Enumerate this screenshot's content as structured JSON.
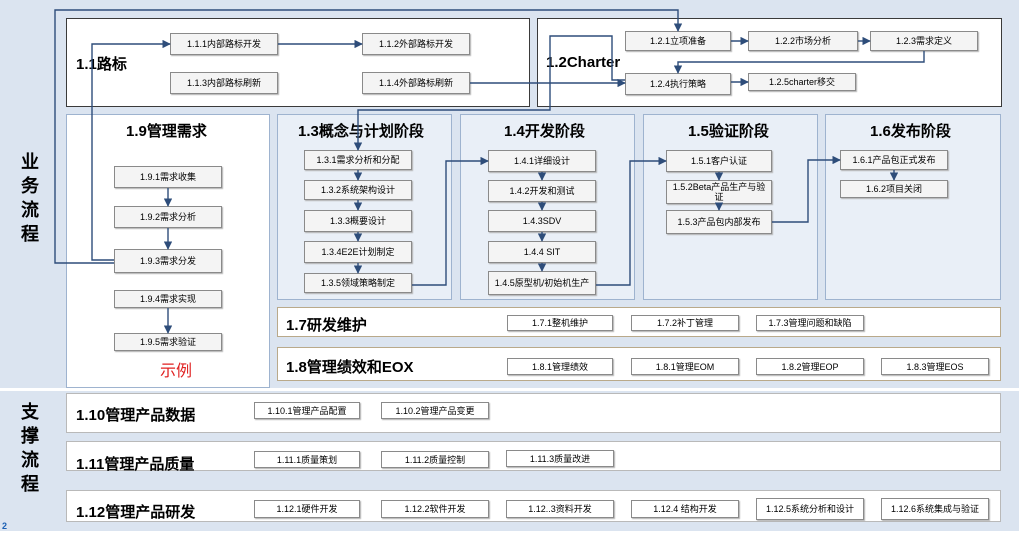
{
  "side_labels": {
    "business": "业务流程",
    "support": "支撑流程"
  },
  "roadmap": {
    "title": "1.1路标",
    "items": [
      "1.1.1内部路标开发",
      "1.1.2外部路标开发",
      "1.1.3内部路标刷新",
      "1.1.4外部路标刷新"
    ]
  },
  "charter": {
    "title": "1.2Charter",
    "items": [
      "1.2.1立项准备",
      "1.2.2市场分析",
      "1.2.3需求定义",
      "1.2.4执行策略",
      "1.2.5charter移交"
    ]
  },
  "mgmt_req": {
    "title": "1.9管理需求",
    "items": [
      "1.9.1需求收集",
      "1.9.2需求分析",
      "1.9.3需求分发",
      "1.9.4需求实现",
      "1.9.5需求验证"
    ],
    "example": "示例"
  },
  "concept": {
    "title": "1.3概念与计划阶段",
    "items": [
      "1.3.1需求分析和分配",
      "1.3.2系统架构设计",
      "1.3.3概要设计",
      "1.3.4E2E计划制定",
      "1.3.5领域策略制定"
    ]
  },
  "develop": {
    "title": "1.4开发阶段",
    "items": [
      "1.4.1详细设计",
      "1.4.2开发和测试",
      "1.4.3SDV",
      "1.4.4 SIT",
      "1.4.5原型机/初始机生产"
    ]
  },
  "verify": {
    "title": "1.5验证阶段",
    "items": [
      "1.5.1客户认证",
      "1.5.2Beta产品生产与验证",
      "1.5.3产品包内部发布"
    ]
  },
  "release": {
    "title": "1.6发布阶段",
    "items": [
      "1.6.1产品包正式发布",
      "1.6.2项目关闭"
    ]
  },
  "rd_maint": {
    "title": "1.7研发维护",
    "items": [
      "1.7.1整机维护",
      "1.7.2补丁管理",
      "1.7.3管理问题和缺陷"
    ]
  },
  "perf_eox": {
    "title": "1.8管理绩效和EOX",
    "items": [
      "1.8.1管理绩效",
      "1.8.1管理EOM",
      "1.8.2管理EOP",
      "1.8.3管理EOS"
    ]
  },
  "prod_data": {
    "title": "1.10管理产品数据",
    "items": [
      "1.10.1管理产品配置",
      "1.10.2管理产品变更"
    ]
  },
  "prod_quality": {
    "title": "1.11管理产品质量",
    "items": [
      "1.11.1质量策划",
      "1.11.2质量控制",
      "1.11.3质量改进"
    ]
  },
  "prod_rd": {
    "title": "1.12管理产品研发",
    "items": [
      "1.12.1硬件开发",
      "1.12.2软件开发",
      "1.12..3资料开发",
      "1.12.4 结构开发",
      "1.12.5系统分析和设计",
      "1.12.6系统集成与验证"
    ]
  },
  "page_number": "2",
  "colors": {
    "band": "#dbe4f0",
    "stage_fill": "#e9eff7",
    "arrow": "#2e4d7a",
    "example_text": "#e02020"
  }
}
